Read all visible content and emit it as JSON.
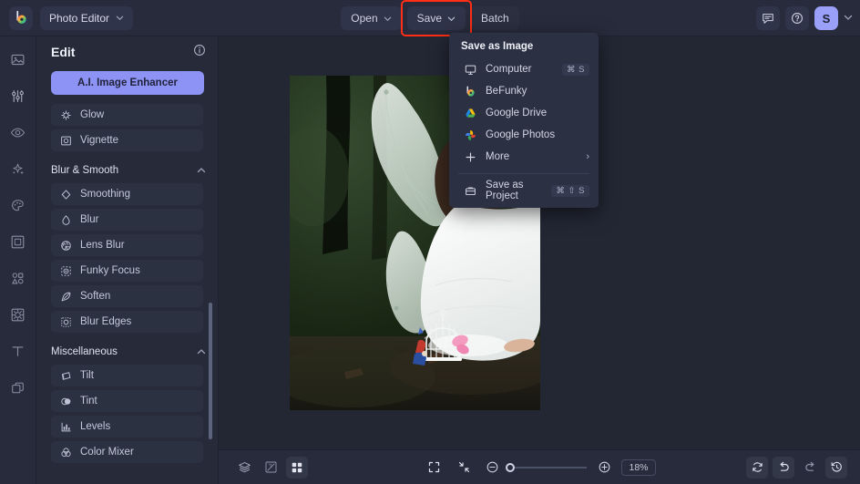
{
  "app": {
    "product_switcher_label": "Photo Editor",
    "logo_icon": "befunky-logo-icon"
  },
  "topbar": {
    "open_label": "Open",
    "save_label": "Save",
    "batch_label": "Batch",
    "save_highlight_color": "#ff2e15",
    "accent_color": "#8d93f5",
    "chat_icon": "chat-bubble-icon",
    "help_icon": "question-circle-icon",
    "avatar_initial": "S"
  },
  "rail": {
    "items": [
      {
        "icon": "image-icon",
        "name": "photos"
      },
      {
        "icon": "sliders-icon",
        "name": "edit"
      },
      {
        "icon": "eye-icon",
        "name": "touch-up"
      },
      {
        "icon": "sparkles-icon",
        "name": "effects"
      },
      {
        "icon": "palette-icon",
        "name": "artsy"
      },
      {
        "icon": "frame-icon",
        "name": "frames"
      },
      {
        "icon": "shapes-icon",
        "name": "graphics"
      },
      {
        "icon": "texture-icon",
        "name": "textures"
      },
      {
        "icon": "text-icon",
        "name": "text"
      },
      {
        "icon": "layers-icon",
        "name": "layers"
      }
    ]
  },
  "panel": {
    "title": "Edit",
    "info_icon": "info-circle-icon",
    "ai_button_label": "A.I. Image Enhancer",
    "top_items": [
      {
        "label": "Glow",
        "icon": "glow-icon"
      },
      {
        "label": "Vignette",
        "icon": "vignette-icon"
      }
    ],
    "sections": [
      {
        "title": "Blur & Smooth",
        "caret": "chevron-up-icon",
        "items": [
          {
            "label": "Smoothing",
            "icon": "diamond-icon"
          },
          {
            "label": "Blur",
            "icon": "droplet-icon"
          },
          {
            "label": "Lens Blur",
            "icon": "aperture-icon"
          },
          {
            "label": "Funky Focus",
            "icon": "focus-icon"
          },
          {
            "label": "Soften",
            "icon": "feather-icon"
          },
          {
            "label": "Blur Edges",
            "icon": "blur-edges-icon"
          }
        ]
      },
      {
        "title": "Miscellaneous",
        "caret": "chevron-up-icon",
        "items": [
          {
            "label": "Tilt",
            "icon": "tilt-icon"
          },
          {
            "label": "Tint",
            "icon": "tint-icon"
          },
          {
            "label": "Levels",
            "icon": "levels-icon"
          },
          {
            "label": "Color Mixer",
            "icon": "color-mixer-icon"
          }
        ]
      }
    ]
  },
  "save_menu": {
    "title": "Save as Image",
    "items": [
      {
        "label": "Computer",
        "icon": "monitor-icon",
        "shortcut": "⌘ S"
      },
      {
        "label": "BeFunky",
        "icon": "befunky-logo-icon",
        "shortcut": ""
      },
      {
        "label": "Google Drive",
        "icon": "google-drive-icon",
        "shortcut": ""
      },
      {
        "label": "Google Photos",
        "icon": "google-photos-icon",
        "shortcut": ""
      },
      {
        "label": "More",
        "icon": "plus-icon",
        "shortcut": "",
        "submenu_arrow": "›"
      }
    ],
    "project_item": {
      "label": "Save as Project",
      "icon": "briefcase-icon",
      "shortcut": "⌘ ⇧ S"
    }
  },
  "bottombar": {
    "layers_icon": "layers-stack-icon",
    "compare_icon": "compare-icon",
    "grid_icon": "grid-icon",
    "fit_icon": "fit-screen-icon",
    "shrink_icon": "shrink-icon",
    "zoom_out_icon": "zoom-out-icon",
    "zoom_in_icon": "zoom-in-icon",
    "zoom_level": "18%",
    "reset_icon": "reset-icon",
    "undo_icon": "undo-icon",
    "redo_icon": "redo-icon",
    "history_icon": "history-icon",
    "slider_position_pct": 0
  },
  "canvas": {
    "image_alt": "fairy-woman-with-wings-in-forest"
  }
}
